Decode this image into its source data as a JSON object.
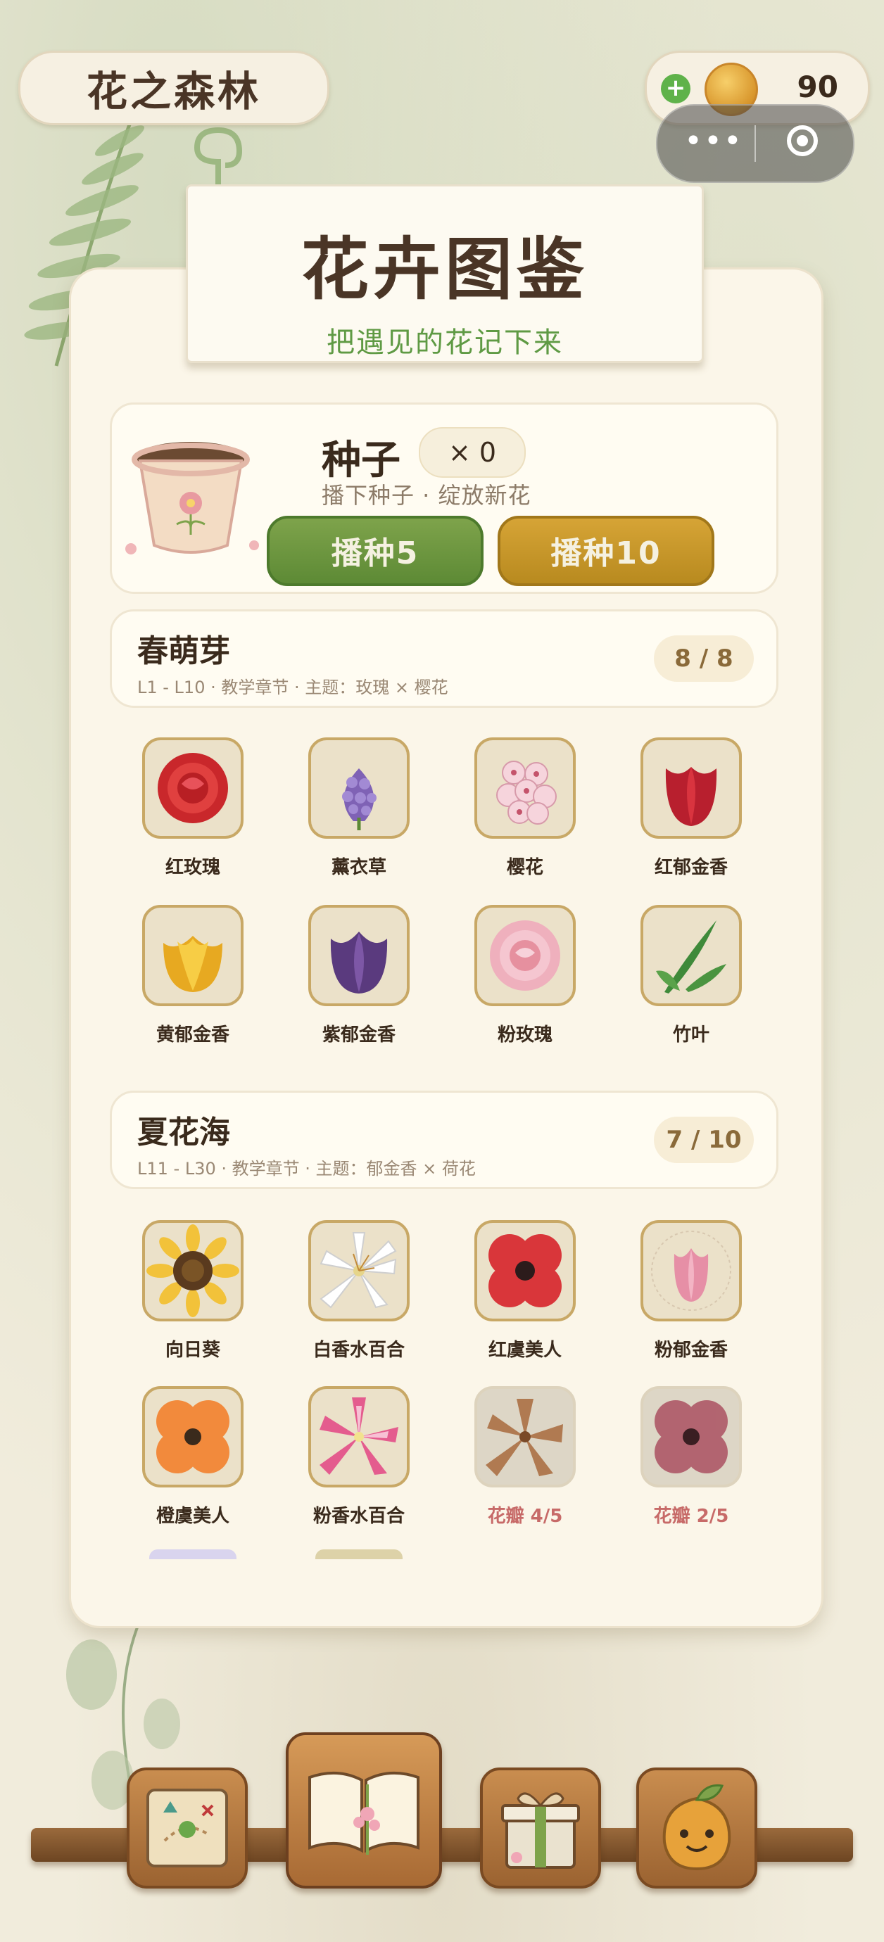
{
  "app": {
    "title": "花之森林",
    "coins": "90"
  },
  "header": {
    "title": "花卉图鉴",
    "subtitle": "把遇见的花记下来"
  },
  "seed": {
    "title": "种子",
    "count": "× 0",
    "subtitle": "播下种子 · 绽放新花",
    "sow5_label": "播种5",
    "sow10_label": "播种10"
  },
  "sections": [
    {
      "title": "春萌芽",
      "subtitle": "L1 - L10  ·  教学章节 · 主题：玫瑰 × 樱花",
      "count": "8 / 8",
      "flowers": [
        {
          "label": "红玫瑰",
          "icon": "red-rose-icon"
        },
        {
          "label": "薰衣草",
          "icon": "lavender-icon"
        },
        {
          "label": "樱花",
          "icon": "cherry-blossom-icon"
        },
        {
          "label": "红郁金香",
          "icon": "red-tulip-icon"
        },
        {
          "label": "黄郁金香",
          "icon": "yellow-tulip-icon"
        },
        {
          "label": "紫郁金香",
          "icon": "purple-tulip-icon"
        },
        {
          "label": "粉玫瑰",
          "icon": "pink-rose-icon"
        },
        {
          "label": "竹叶",
          "icon": "bamboo-leaf-icon"
        }
      ]
    },
    {
      "title": "夏花海",
      "subtitle": "L11 - L30  ·  教学章节 · 主题：郁金香 × 荷花",
      "count": "7 / 10",
      "flowers": [
        {
          "label": "向日葵",
          "icon": "sunflower-icon"
        },
        {
          "label": "白香水百合",
          "icon": "white-lily-icon"
        },
        {
          "label": "红虞美人",
          "icon": "red-poppy-icon"
        },
        {
          "label": "粉郁金香",
          "icon": "pink-tulip-icon"
        },
        {
          "label": "橙虞美人",
          "icon": "orange-poppy-icon"
        },
        {
          "label": "粉香水百合",
          "icon": "pink-lily-icon"
        },
        {
          "label": "花瓣 4/5",
          "icon": "lily-silhouette-icon",
          "progress": 0.8
        },
        {
          "label": "花瓣 2/5",
          "icon": "poppy-silhouette-icon",
          "progress": 0.4
        }
      ]
    }
  ],
  "nav": [
    {
      "name": "map",
      "icon": "treasure-map-icon"
    },
    {
      "name": "encyclopedia",
      "icon": "open-book-icon",
      "active": true
    },
    {
      "name": "gift",
      "icon": "gift-box-icon"
    },
    {
      "name": "pet",
      "icon": "sprout-face-icon"
    }
  ],
  "colors": {
    "background": "#f1ecdc",
    "panel": "#fbf6e9",
    "accent_green": "#5f9a44",
    "accent_gold": "#c8a866",
    "text_dark": "#3a2a1c",
    "progress_text": "#c76a68"
  }
}
